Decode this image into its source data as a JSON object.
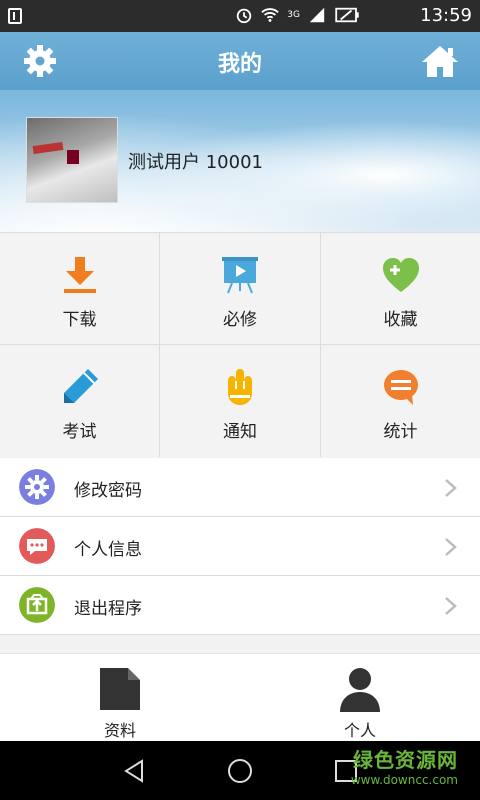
{
  "status_bar": {
    "time": "13:59",
    "network_label": "3G"
  },
  "header": {
    "title": "我的"
  },
  "profile": {
    "username": "测试用户 10001"
  },
  "grid": [
    {
      "label": "下载",
      "icon": "download-icon",
      "color": "#f07d1e"
    },
    {
      "label": "必修",
      "icon": "video-board-icon",
      "color": "#4aa8dc"
    },
    {
      "label": "收藏",
      "icon": "heart-plus-icon",
      "color": "#7cc04a"
    },
    {
      "label": "考试",
      "icon": "pencil-icon",
      "color": "#2a9bd6"
    },
    {
      "label": "通知",
      "icon": "hand-icon",
      "color": "#f4b400"
    },
    {
      "label": "统计",
      "icon": "chat-bubble-icon",
      "color": "#f08030"
    }
  ],
  "menu": [
    {
      "label": "修改密码",
      "icon": "gear-icon",
      "color": "#7a7ee0"
    },
    {
      "label": "个人信息",
      "icon": "message-icon",
      "color": "#e25a5a"
    },
    {
      "label": "退出程序",
      "icon": "exit-icon",
      "color": "#7db428"
    }
  ],
  "tabs": [
    {
      "label": "资料",
      "icon": "document-icon"
    },
    {
      "label": "个人",
      "icon": "person-icon"
    }
  ],
  "watermark": {
    "title": "绿色资源网",
    "url": "www.downcc.com"
  }
}
